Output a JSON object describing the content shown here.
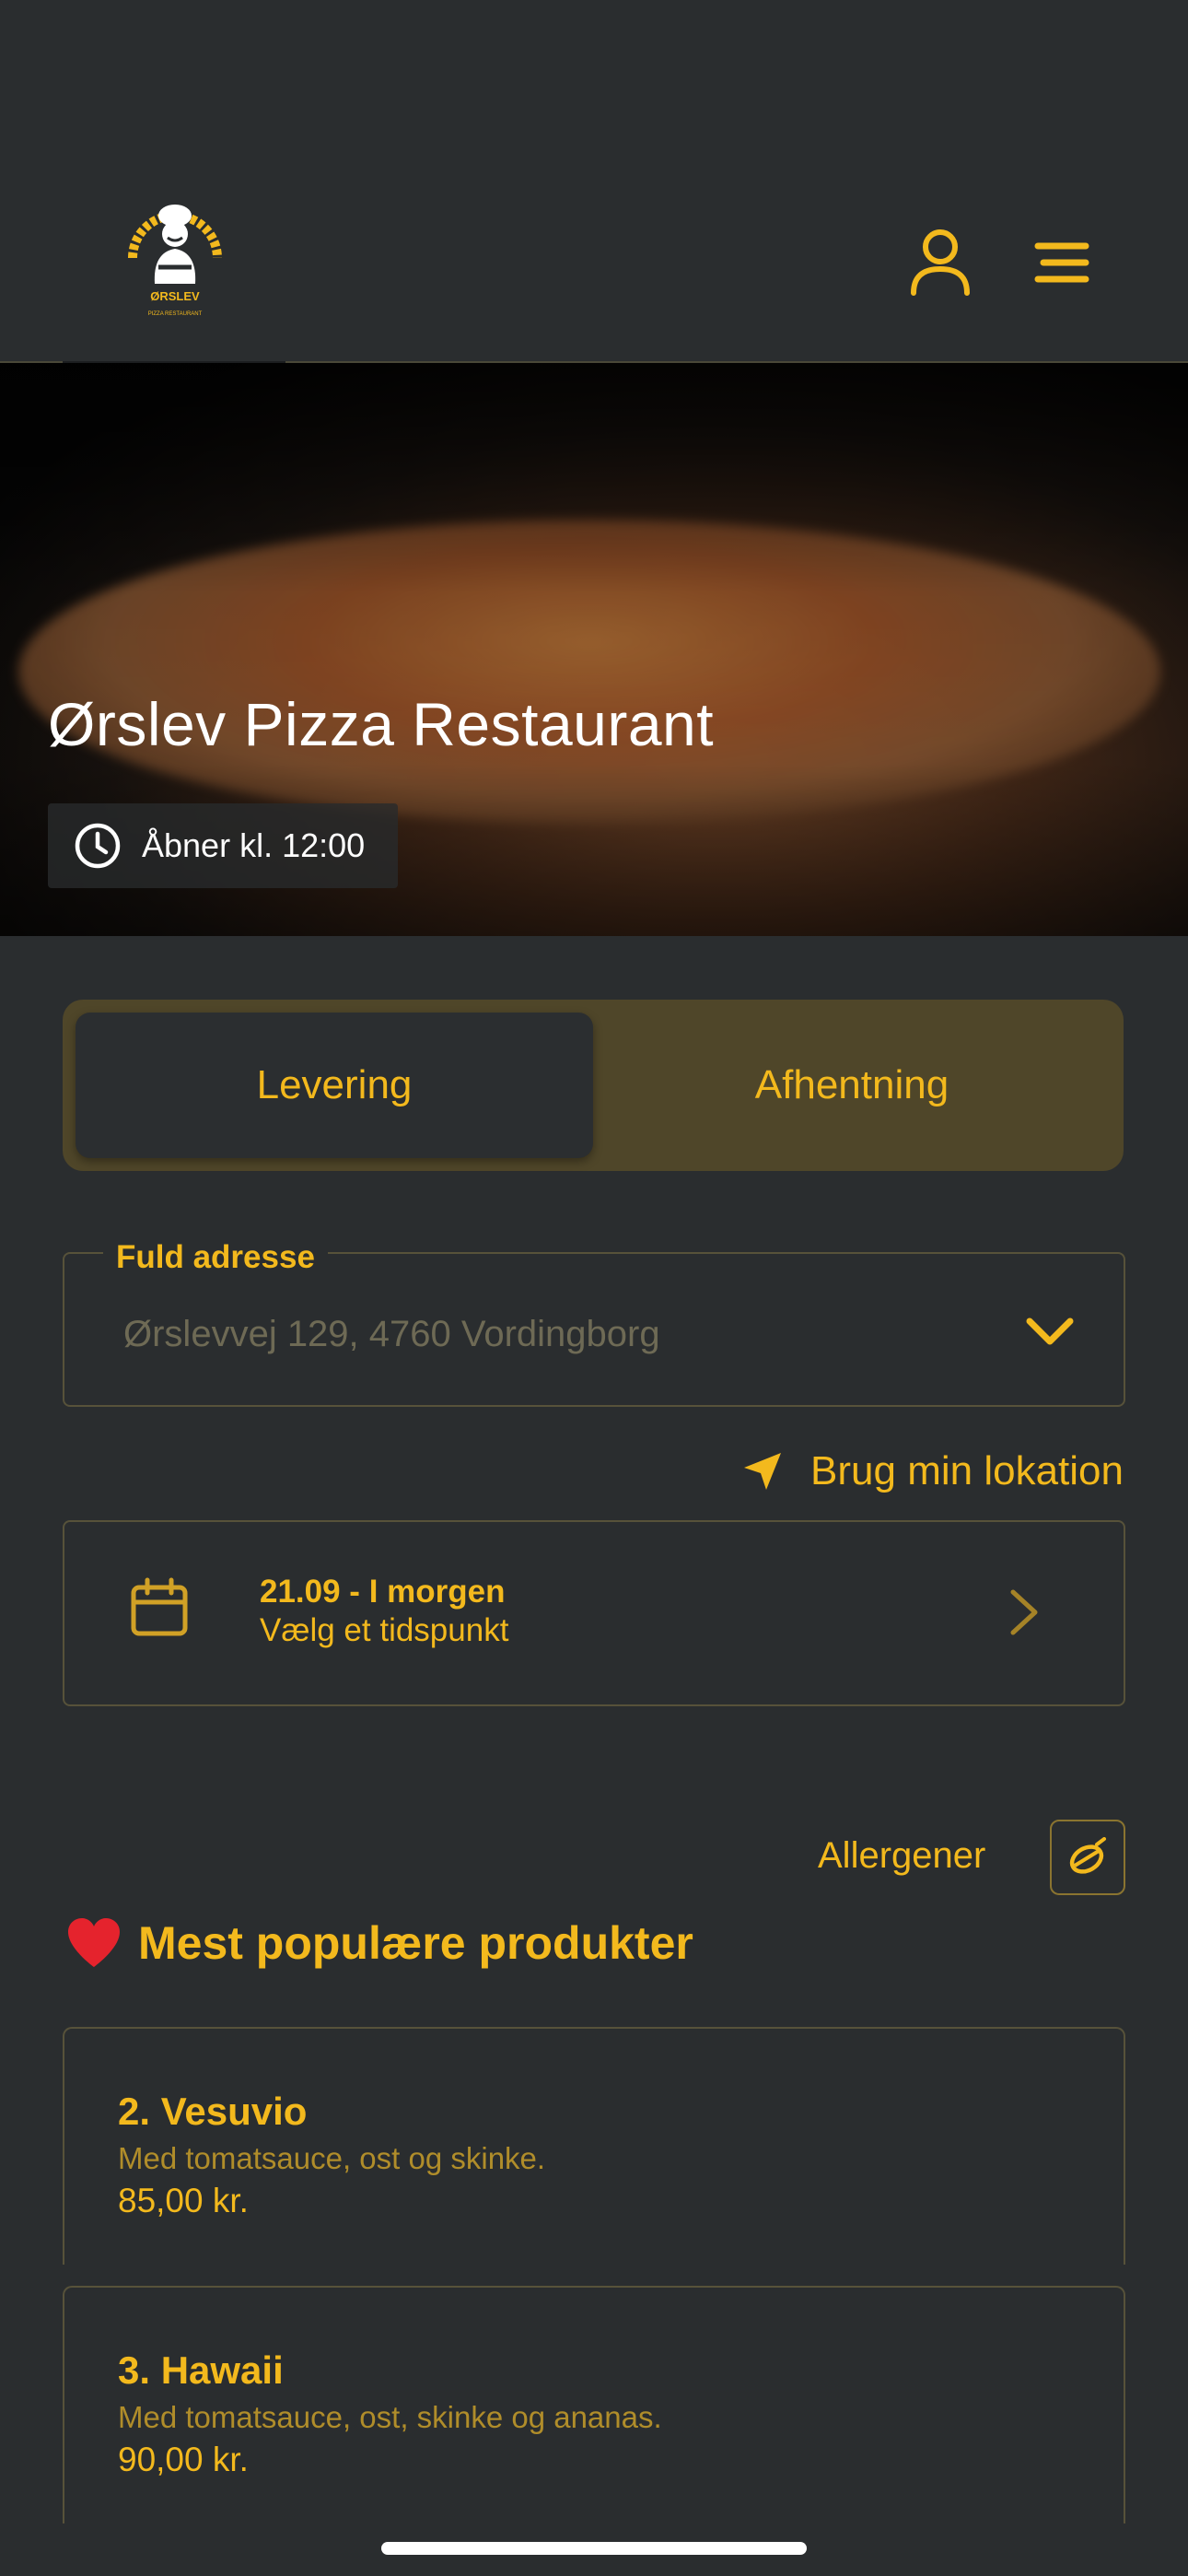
{
  "colors": {
    "accent": "#f3b91d",
    "background": "#2a2d2f",
    "toggle_bg": "#4f4629",
    "border": "#57523a",
    "muted": "#6e6a55"
  },
  "header": {
    "logo_text": "ØRSLEV",
    "logo_subtext": "PIZZA RESTAURANT",
    "icons": [
      "user-icon",
      "menu-icon"
    ]
  },
  "hero": {
    "title": "Ørslev Pizza Restaurant",
    "open_status": "Åbner kl. 12:00",
    "icon": "clock-icon"
  },
  "order_type": {
    "tabs": [
      {
        "label": "Levering",
        "active": true
      },
      {
        "label": "Afhentning",
        "active": false
      }
    ]
  },
  "address": {
    "label": "Fuld adresse",
    "placeholder": "Ørslevvej 129, 4760 Vordingborg",
    "icon": "chevron-down-icon"
  },
  "location": {
    "label": "Brug min lokation",
    "icon": "location-arrow-icon"
  },
  "schedule": {
    "date": "21.09 - I morgen",
    "prompt": "Vælg et tidspunkt",
    "icons": [
      "calendar-icon",
      "chevron-right-icon"
    ]
  },
  "allergens": {
    "label": "Allergener",
    "icon": "allergen-icon"
  },
  "popular": {
    "title": "Mest populære produkter",
    "icon": "heart-icon",
    "products": [
      {
        "name": "2. Vesuvio",
        "description": "Med tomatsauce, ost og skinke.",
        "price": "85,00 kr."
      },
      {
        "name": "3. Hawaii",
        "description": "Med tomatsauce, ost, skinke og ananas.",
        "price": "90,00 kr."
      }
    ]
  }
}
